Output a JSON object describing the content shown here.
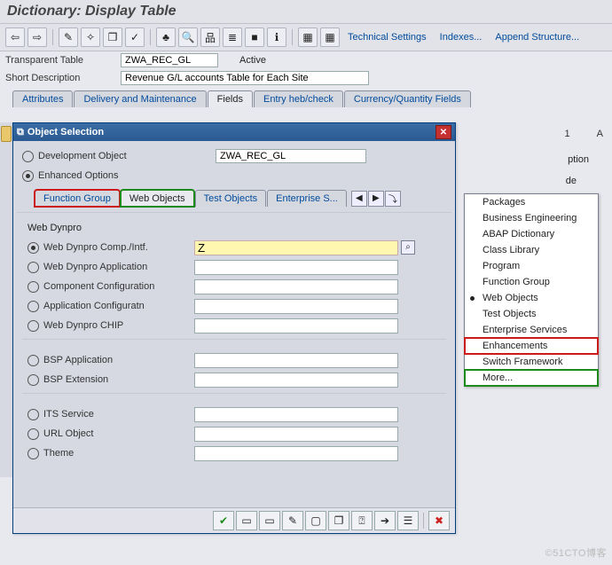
{
  "title": "Dictionary: Display Table",
  "toolbar_text": {
    "tech": "Technical Settings",
    "idx": "Indexes...",
    "app": "Append Structure..."
  },
  "header": {
    "table_lbl": "Transparent Table",
    "table_val": "ZWA_REC_GL",
    "status": "Active",
    "desc_lbl": "Short Description",
    "desc_val": "Revenue G/L accounts Table for Each Site"
  },
  "main_tabs": [
    "Attributes",
    "Delivery and Maintenance",
    "Fields",
    "Entry heb/check",
    "Currency/Quantity Fields"
  ],
  "main_tabs_active": 2,
  "right": {
    "page": "1",
    "a": "A",
    "label_ption": "ption",
    "label_de": "de"
  },
  "dialog": {
    "title": "Object Selection",
    "top_opts": {
      "dev": "Development Object",
      "enh": "Enhanced Options"
    },
    "top_selected": "enh",
    "top_val": "ZWA_REC_GL",
    "subtabs": [
      "Function Group",
      "Web Objects",
      "Test Objects",
      "Enterprise S..."
    ],
    "subtabs_active": 1,
    "section1_title": "Web Dynpro",
    "rows1": [
      {
        "lbl": "Web Dynpro Comp./Intf.",
        "sel": true,
        "val": "Z",
        "hl": true
      },
      {
        "lbl": "Web Dynpro Application",
        "sel": false,
        "val": ""
      },
      {
        "lbl": "Component Configuration",
        "sel": false,
        "val": ""
      },
      {
        "lbl": "Application Configuratn",
        "sel": false,
        "val": ""
      },
      {
        "lbl": "Web Dynpro CHIP",
        "sel": false,
        "val": ""
      }
    ],
    "rows2": [
      {
        "lbl": "BSP Application",
        "sel": false,
        "val": ""
      },
      {
        "lbl": "BSP Extension",
        "sel": false,
        "val": ""
      }
    ],
    "rows3": [
      {
        "lbl": "ITS Service",
        "sel": false,
        "val": ""
      },
      {
        "lbl": "URL Object",
        "sel": false,
        "val": ""
      },
      {
        "lbl": "Theme",
        "sel": false,
        "val": ""
      }
    ]
  },
  "menu": {
    "items": [
      "Packages",
      "Business Engineering",
      "ABAP Dictionary",
      "Class Library",
      "Program",
      "Function Group",
      "Web Objects",
      "Test Objects",
      "Enterprise Services",
      "Enhancements",
      "Switch Framework",
      "More..."
    ],
    "dot_index": 6,
    "red_index": 9,
    "green_index": 11
  },
  "watermark": "©51CTO博客"
}
